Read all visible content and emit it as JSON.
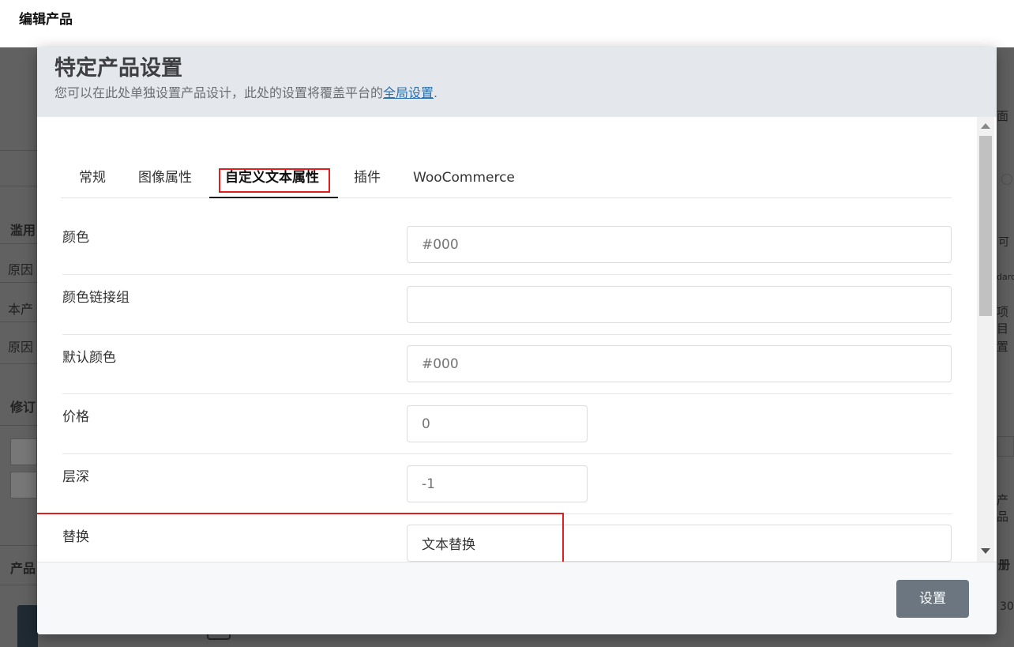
{
  "page": {
    "title": "编辑产品"
  },
  "background": {
    "left_fragments": [
      "滥用",
      "原因",
      "本产",
      "原因",
      "修订",
      "产品"
    ],
    "right_fragments": [
      "面",
      "可",
      "dard",
      "项目",
      "置",
      "产品",
      "册",
      "30"
    ]
  },
  "modal": {
    "title": "特定产品设置",
    "subtitle_prefix": "您可以在此处单独设置产品设计，此处的设置将覆盖平台的",
    "subtitle_link": "全局设置",
    "subtitle_suffix": ".",
    "tabs": [
      {
        "label": "常规",
        "active": false
      },
      {
        "label": "图像属性",
        "active": false
      },
      {
        "label": "自定义文本属性",
        "active": true
      },
      {
        "label": "插件",
        "active": false
      },
      {
        "label": "WooCommerce",
        "active": false
      }
    ],
    "fields": [
      {
        "label": "颜色",
        "value": "",
        "placeholder": "#000"
      },
      {
        "label": "颜色链接组",
        "value": "",
        "placeholder": ""
      },
      {
        "label": "默认颜色",
        "value": "",
        "placeholder": "#000"
      },
      {
        "label": "价格",
        "value": "",
        "placeholder": "0"
      },
      {
        "label": "层深",
        "value": "",
        "placeholder": "-1"
      },
      {
        "label": "替换",
        "value": "文本替换",
        "placeholder": ""
      }
    ],
    "footer": {
      "set_button": "设置"
    }
  },
  "colors": {
    "header_bg": "#e4e8ec",
    "button_bg": "#6b7680",
    "link": "#2a6fb0",
    "highlight": "#e02020"
  }
}
